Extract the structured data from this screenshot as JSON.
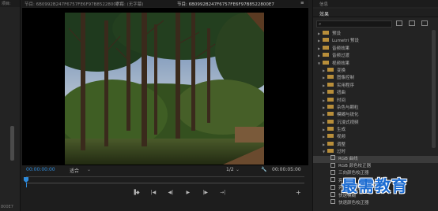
{
  "left_panel": {
    "header": "项目:",
    "footer": "800E7"
  },
  "monitor_header": {
    "source_label": "节目: 6B0992B247F6757FE6F97B8522800E7",
    "title_label": "字幕: (无字幕)",
    "program_label": "节目: 6B0992B247F6757FE6F97B8522800E7",
    "menu_glyph": "≡"
  },
  "viewer": {
    "timecode_in": "00:00:00:00",
    "fit": "适合",
    "resolution": "1/2",
    "timecode_out": "00:00:05:00"
  },
  "transport": {
    "buttons": [
      "▐◆",
      "|◀",
      "◀|",
      "▶",
      "|▶",
      "→|"
    ],
    "add": "+"
  },
  "right_panel": {
    "info_label": "信息",
    "effects_label": "效果",
    "search_icon_glyph": "⌕",
    "tree": [
      {
        "level": 0,
        "type": "folder",
        "expanded": false,
        "label": "预设"
      },
      {
        "level": 0,
        "type": "folder",
        "expanded": false,
        "label": "Lumetri 预设"
      },
      {
        "level": 0,
        "type": "folder",
        "expanded": false,
        "label": "音频效果"
      },
      {
        "level": 0,
        "type": "folder",
        "expanded": false,
        "label": "音频过渡"
      },
      {
        "level": 0,
        "type": "folder",
        "expanded": true,
        "label": "视频效果"
      },
      {
        "level": 1,
        "type": "folder",
        "expanded": false,
        "label": "变换"
      },
      {
        "level": 1,
        "type": "folder",
        "expanded": false,
        "label": "图像控制"
      },
      {
        "level": 1,
        "type": "folder",
        "expanded": false,
        "label": "实用程序"
      },
      {
        "level": 1,
        "type": "folder",
        "expanded": false,
        "label": "扭曲"
      },
      {
        "level": 1,
        "type": "folder",
        "expanded": false,
        "label": "时间"
      },
      {
        "level": 1,
        "type": "folder",
        "expanded": false,
        "label": "杂色与颗粒"
      },
      {
        "level": 1,
        "type": "folder",
        "expanded": false,
        "label": "模糊与锐化"
      },
      {
        "level": 1,
        "type": "folder",
        "expanded": false,
        "label": "沉浸式视频"
      },
      {
        "level": 1,
        "type": "folder",
        "expanded": false,
        "label": "生成"
      },
      {
        "level": 1,
        "type": "folder",
        "expanded": false,
        "label": "视频"
      },
      {
        "level": 1,
        "type": "folder",
        "expanded": false,
        "label": "调整"
      },
      {
        "level": 1,
        "type": "folder",
        "expanded": true,
        "label": "过时"
      },
      {
        "level": 2,
        "type": "effect",
        "expanded": false,
        "label": "RGB 曲线",
        "selected": true
      },
      {
        "level": 2,
        "type": "effect",
        "expanded": false,
        "label": "RGB 颜色校正器"
      },
      {
        "level": 2,
        "type": "effect",
        "expanded": false,
        "label": "三向颜色校正器"
      },
      {
        "level": 2,
        "type": "effect",
        "expanded": false,
        "label": "亮度曲线"
      },
      {
        "level": 2,
        "type": "effect",
        "expanded": false,
        "label": "亮度校正器"
      },
      {
        "level": 2,
        "type": "effect",
        "expanded": false,
        "label": "快速模糊"
      },
      {
        "level": 2,
        "type": "effect",
        "expanded": false,
        "label": "快速颜色校正器"
      }
    ]
  },
  "watermark": "最需教育",
  "colors": {
    "accent": "#2e8bdb",
    "folder": "#b88e3a",
    "watermark": "#1b6bd1"
  }
}
